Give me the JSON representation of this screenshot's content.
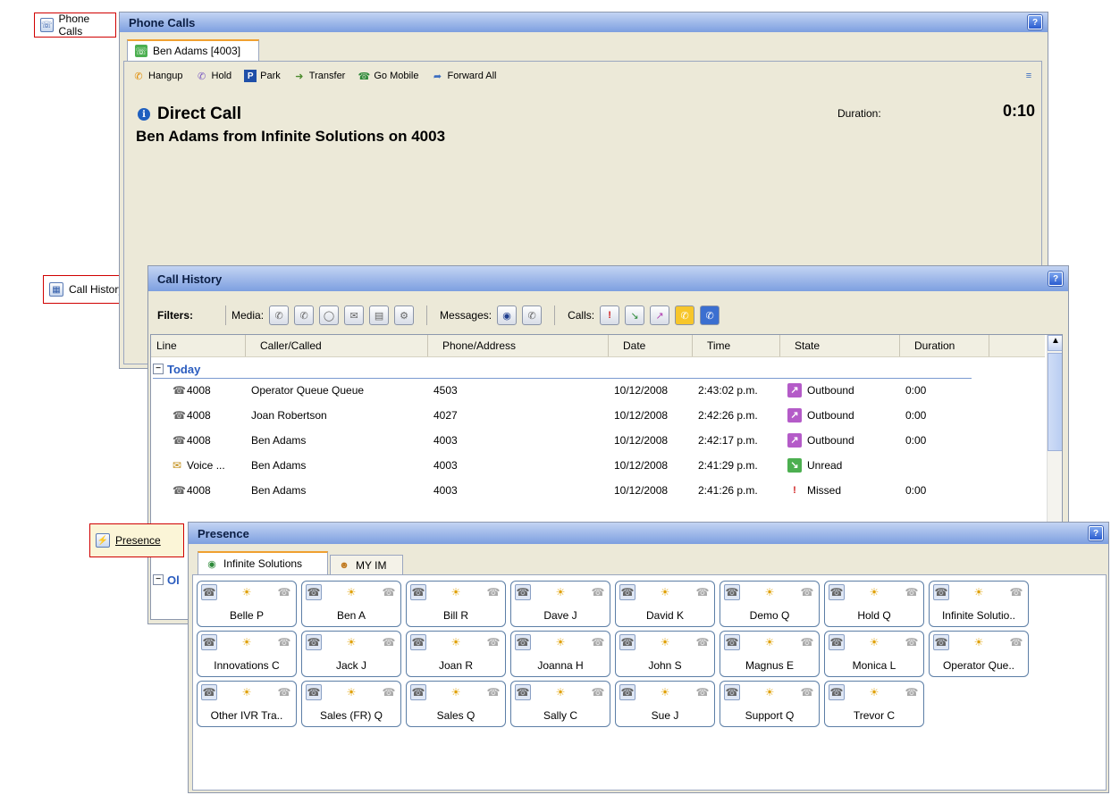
{
  "launchers": {
    "phone_calls": "Phone Calls",
    "call_history": "Call History",
    "presence": "Presence"
  },
  "phone_calls": {
    "title": "Phone Calls",
    "help": "?",
    "tab_label": "Ben Adams [4003]",
    "toolbar": {
      "hangup": "Hangup",
      "hold": "Hold",
      "park": "Park",
      "transfer": "Transfer",
      "go_mobile": "Go Mobile",
      "forward_all": "Forward All"
    },
    "call_type": "Direct Call",
    "call_detail": "Ben Adams from Infinite Solutions on 4003",
    "duration_label": "Duration:",
    "duration_value": "0:10"
  },
  "call_history": {
    "title": "Call History",
    "help": "?",
    "filters_label": "Filters:",
    "media_label": "Media:",
    "messages_label": "Messages:",
    "calls_label": "Calls:",
    "columns": [
      "Line",
      "Caller/Called",
      "Phone/Address",
      "Date",
      "Time",
      "State",
      "Duration"
    ],
    "group_today": "Today",
    "group_other": "Ol",
    "rows": [
      {
        "line": "4008",
        "caller": "Operator Queue Queue",
        "phone": "4503",
        "date": "10/12/2008",
        "time": "2:43:02 p.m.",
        "state": "Outbound",
        "duration": "0:00"
      },
      {
        "line": "4008",
        "caller": "Joan Robertson",
        "phone": "4027",
        "date": "10/12/2008",
        "time": "2:42:26 p.m.",
        "state": "Outbound",
        "duration": "0:00"
      },
      {
        "line": "4008",
        "caller": "Ben Adams",
        "phone": "4003",
        "date": "10/12/2008",
        "time": "2:42:17 p.m.",
        "state": "Outbound",
        "duration": "0:00"
      },
      {
        "line": "Voice ...",
        "caller": "Ben Adams",
        "phone": "4003",
        "date": "10/12/2008",
        "time": "2:41:29 p.m.",
        "state": "Unread",
        "duration": ""
      },
      {
        "line": "4008",
        "caller": "Ben Adams",
        "phone": "4003",
        "date": "10/12/2008",
        "time": "2:41:26 p.m.",
        "state": "Missed",
        "duration": "0:00"
      }
    ]
  },
  "presence": {
    "title": "Presence",
    "help": "?",
    "tabs": [
      "Infinite Solutions",
      "MY IM"
    ],
    "cards": [
      {
        "name": "Belle P"
      },
      {
        "name": "Ben A"
      },
      {
        "name": "Bill R"
      },
      {
        "name": "Dave J"
      },
      {
        "name": "David K"
      },
      {
        "name": "Demo Q"
      },
      {
        "name": "Hold Q"
      },
      {
        "name": "Infinite Solutio.."
      },
      {
        "name": "Innovations C"
      },
      {
        "name": "Jack J"
      },
      {
        "name": "Joan R"
      },
      {
        "name": "Joanna H"
      },
      {
        "name": "John S"
      },
      {
        "name": "Magnus E"
      },
      {
        "name": "Monica L"
      },
      {
        "name": "Operator Que.."
      },
      {
        "name": "Other IVR Tra.."
      },
      {
        "name": "Sales (FR) Q"
      },
      {
        "name": "Sales Q"
      },
      {
        "name": "Sally C"
      },
      {
        "name": "Sue J"
      },
      {
        "name": "Support Q"
      },
      {
        "name": "Trevor C"
      }
    ]
  }
}
